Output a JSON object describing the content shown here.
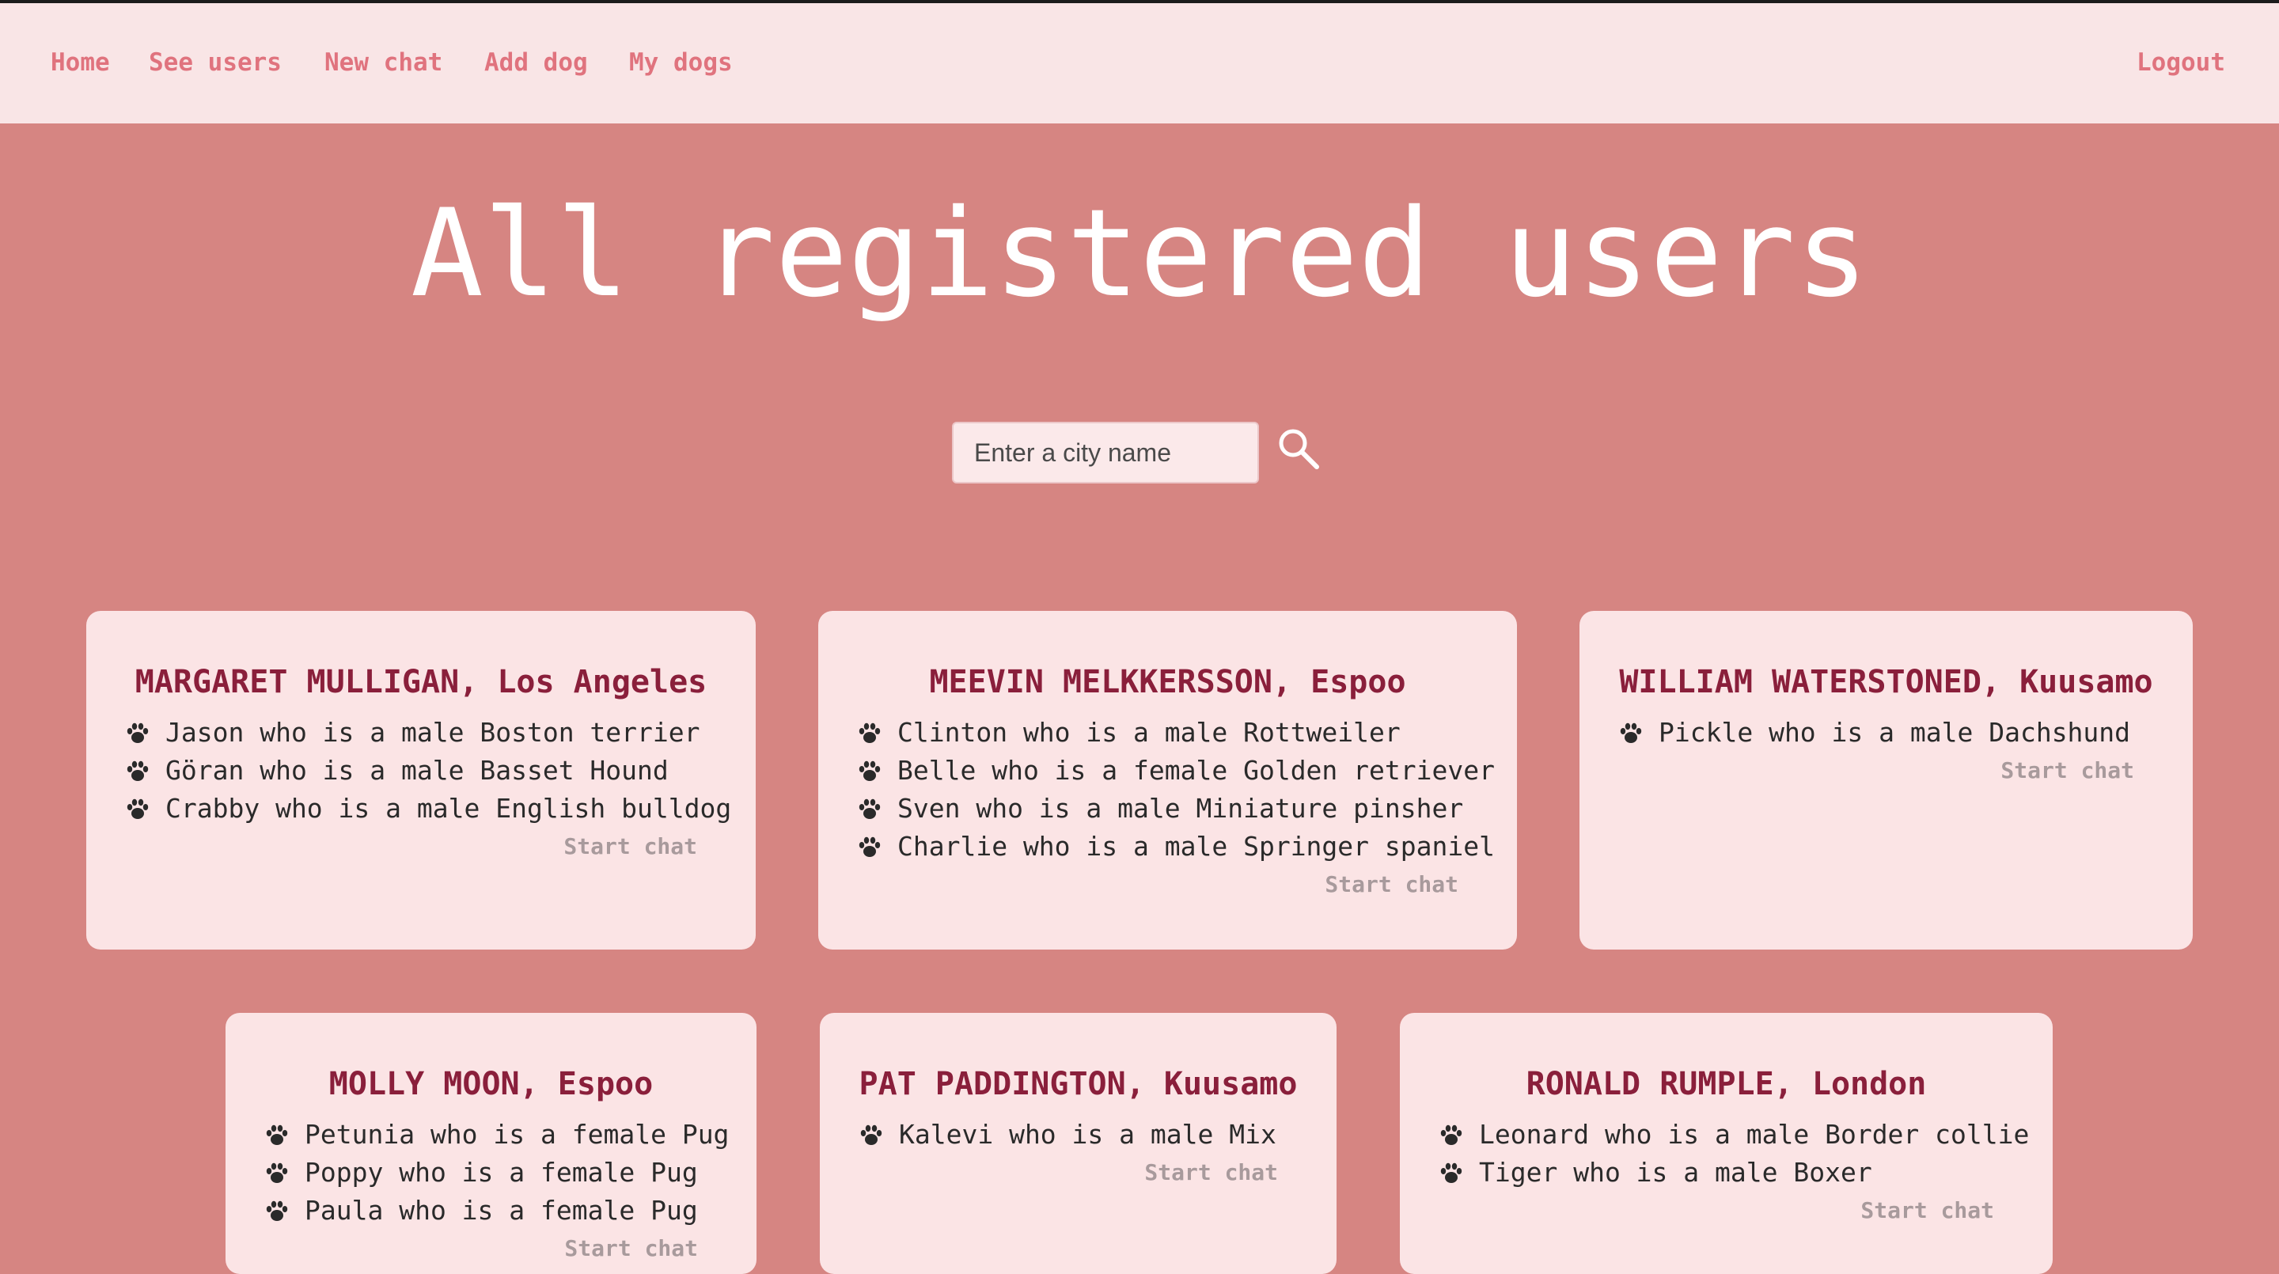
{
  "nav": {
    "items": [
      "Home",
      "See users",
      "New chat",
      "Add dog",
      "My dogs"
    ],
    "logout": "Logout"
  },
  "page_title": "All registered users",
  "search": {
    "placeholder": "Enter a city name",
    "value": ""
  },
  "start_chat_label": "Start chat",
  "users": [
    {
      "name": "MARGARET MULLIGAN, Los Angeles",
      "dogs": [
        "Jason who is a male Boston terrier",
        "Göran who is a male Basset Hound",
        "Crabby who is a male English bulldog"
      ]
    },
    {
      "name": "MEEVIN MELKKERSSON, Espoo",
      "dogs": [
        "Clinton who is a male Rottweiler",
        "Belle who is a female Golden retriever",
        "Sven who is a male Miniature pinsher",
        "Charlie who is a male Springer spaniel"
      ]
    },
    {
      "name": "WILLIAM WATERSTONED, Kuusamo",
      "dogs": [
        "Pickle who is a male Dachshund"
      ]
    },
    {
      "name": "MOLLY MOON, Espoo",
      "dogs": [
        "Petunia who is a female Pug",
        "Poppy who is a female Pug",
        "Paula who is a female Pug"
      ]
    },
    {
      "name": "PAT PADDINGTON, Kuusamo",
      "dogs": [
        "Kalevi who is a male Mix"
      ]
    },
    {
      "name": "RONALD RUMPLE, London",
      "dogs": [
        "Leonard who is a male Border collie",
        "Tiger who is a male Boxer"
      ]
    }
  ],
  "colors": {
    "background": "#d68582",
    "nav_background": "#f9e5e6",
    "nav_link": "#e0737e",
    "card_background": "#fbe4e5",
    "card_title": "#8a1f3b",
    "start_chat": "#a89a9c"
  },
  "icons": {
    "search": "search-icon",
    "dog": "paw-icon"
  }
}
